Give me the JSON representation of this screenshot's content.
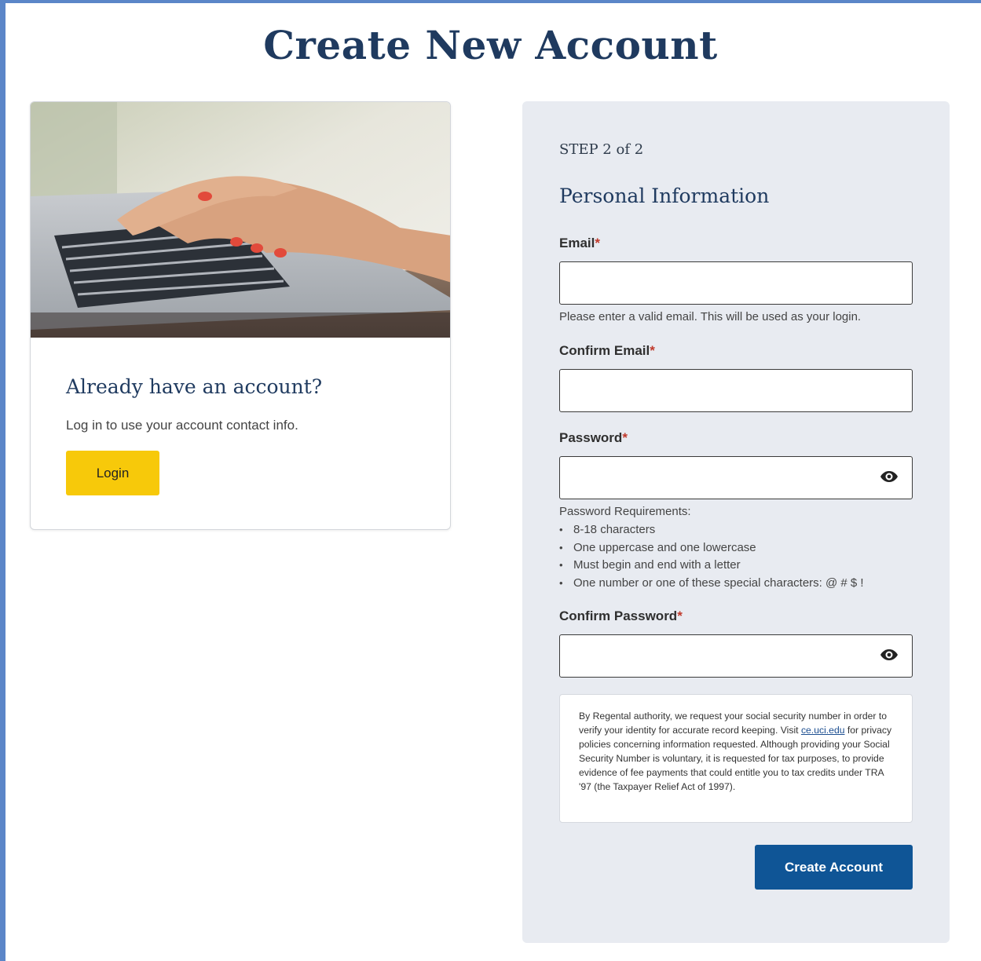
{
  "page": {
    "title": "Create New Account"
  },
  "login_card": {
    "heading": "Already have an account?",
    "text": "Log in to use your account contact info.",
    "login_label": "Login"
  },
  "form": {
    "step": "STEP 2 of 2",
    "section_title": "Personal Information",
    "required_mark": "*",
    "email": {
      "label": "Email",
      "value": "",
      "placeholder": "",
      "hint": "Please enter a valid email. This will be used as your login."
    },
    "confirm_email": {
      "label": "Confirm Email",
      "value": "",
      "placeholder": ""
    },
    "password": {
      "label": "Password",
      "value": "",
      "placeholder": "",
      "icon": "eye-icon"
    },
    "password_requirements": {
      "title": "Password Requirements:",
      "items": [
        "8-18 characters",
        "One uppercase and one lowercase",
        "Must begin and end with a letter",
        "One number or one of these special characters: @ # $ !"
      ]
    },
    "confirm_password": {
      "label": "Confirm Password",
      "value": "",
      "placeholder": "",
      "icon": "eye-icon"
    },
    "notice": {
      "before_link": "By Regental authority, we request your social security number in order to verify your identity for accurate record keeping. Visit ",
      "link_text": "ce.uci.edu",
      "after_link": " for privacy policies concerning information requested. Although providing your Social Security Number is voluntary, it is requested for tax purposes, to provide evidence of fee payments that could entitle you to tax credits under TRA '97 (the Taxpayer Relief Act of 1997)."
    },
    "submit_label": "Create Account"
  },
  "colors": {
    "heading": "#1f3a5f",
    "login_button": "#f7c90a",
    "primary_button": "#0f5596",
    "panel_background": "#e8ebf1",
    "required": "#c0392b",
    "frame_border": "#5b86c8"
  }
}
